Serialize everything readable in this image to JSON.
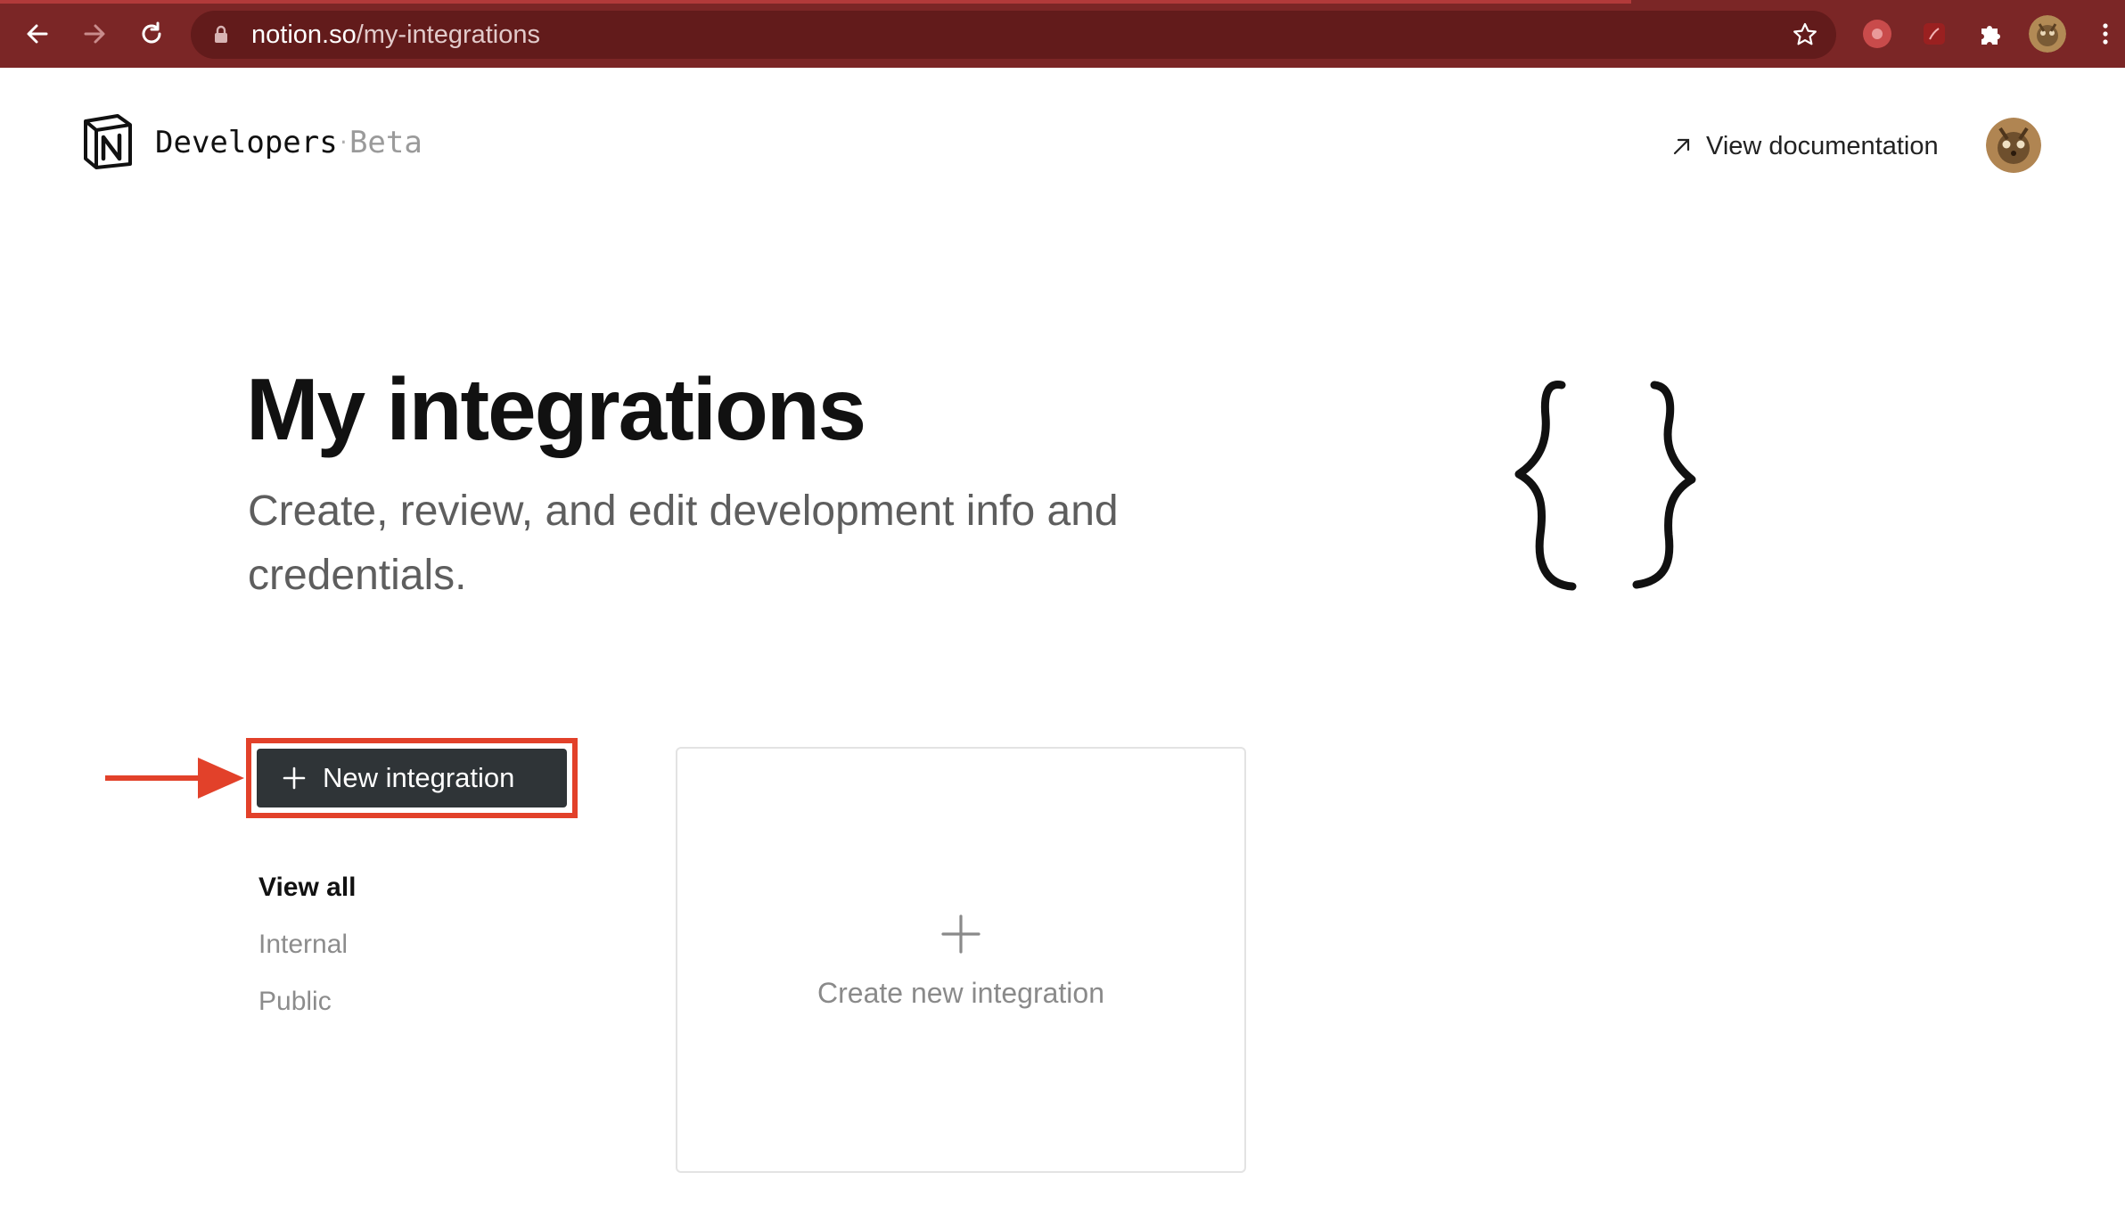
{
  "browser": {
    "url_host": "notion.so",
    "url_path": "/my-integrations",
    "toolbar_color": "#7b2626"
  },
  "header": {
    "brand": "Developers",
    "separator": "·",
    "beta": "Beta",
    "view_documentation": "View documentation"
  },
  "hero": {
    "title": "My integrations",
    "subtitle": "Create, review, and edit development info and credentials."
  },
  "actions": {
    "new_integration": "New integration",
    "highlight_color": "#e2412a"
  },
  "filters": {
    "items": [
      "View all",
      "Internal",
      "Public"
    ],
    "active": "View all"
  },
  "card": {
    "create_label": "Create new integration"
  }
}
